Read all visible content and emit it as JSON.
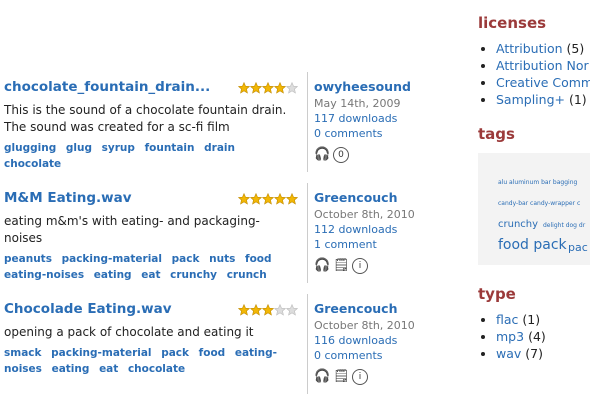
{
  "results": [
    {
      "title": "chocolate_fountain_drain...",
      "rating": 4,
      "description": "This is the sound of a chocolate fountain drain. The sound was created for a sc-fi film",
      "tags": [
        "glugging",
        "glug",
        "syrup",
        "fountain",
        "drain",
        "chocolate"
      ],
      "user": "owyheesound",
      "date": "May 14th, 2009",
      "downloads": "117 downloads",
      "comments": "0 comments"
    },
    {
      "title": "M&M Eating.wav",
      "rating": 5,
      "description": "eating m&m's with eating- and packaging-noises",
      "tags": [
        "peanuts",
        "packing-material",
        "pack",
        "nuts",
        "food",
        "eating-noises",
        "eating",
        "eat",
        "crunchy",
        "crunch"
      ],
      "user": "Greencouch",
      "date": "October 8th, 2010",
      "downloads": "112 downloads",
      "comments": "1 comment"
    },
    {
      "title": "Chocolade Eating.wav",
      "rating": 3,
      "description": "opening a pack of chocolate and eating it",
      "tags": [
        "smack",
        "packing-material",
        "pack",
        "food",
        "eating-noises",
        "eating",
        "eat",
        "chocolate"
      ],
      "user": "Greencouch",
      "date": "October 8th, 2010",
      "downloads": "116 downloads",
      "comments": "0 comments"
    }
  ],
  "sidebar": {
    "licenses_heading": "licenses",
    "licenses": [
      {
        "label": "Attribution",
        "count": "(5)"
      },
      {
        "label": "Attribution Nor",
        "count": ""
      },
      {
        "label": "Creative Comm",
        "count": ""
      },
      {
        "label": "Sampling+",
        "count": "(1)"
      }
    ],
    "tags_heading": "tags",
    "tagcloud": [
      {
        "text": "alu  aluminum  bar  bagging"
      },
      {
        "text": "candy-bar  candy-wrapper  c"
      },
      {
        "text": "crunchy"
      },
      {
        "text": "delight  dog  dr"
      },
      {
        "text": "food pack"
      },
      {
        "text": "pac"
      }
    ],
    "type_heading": "type",
    "types": [
      {
        "label": "flac",
        "count": "(1)"
      },
      {
        "label": "mp3",
        "count": "(4)"
      },
      {
        "label": "wav",
        "count": "(7)"
      }
    ]
  },
  "colors": {
    "link": "#2a6db5",
    "heading": "#9b3a3a",
    "star": "#f2b705"
  }
}
